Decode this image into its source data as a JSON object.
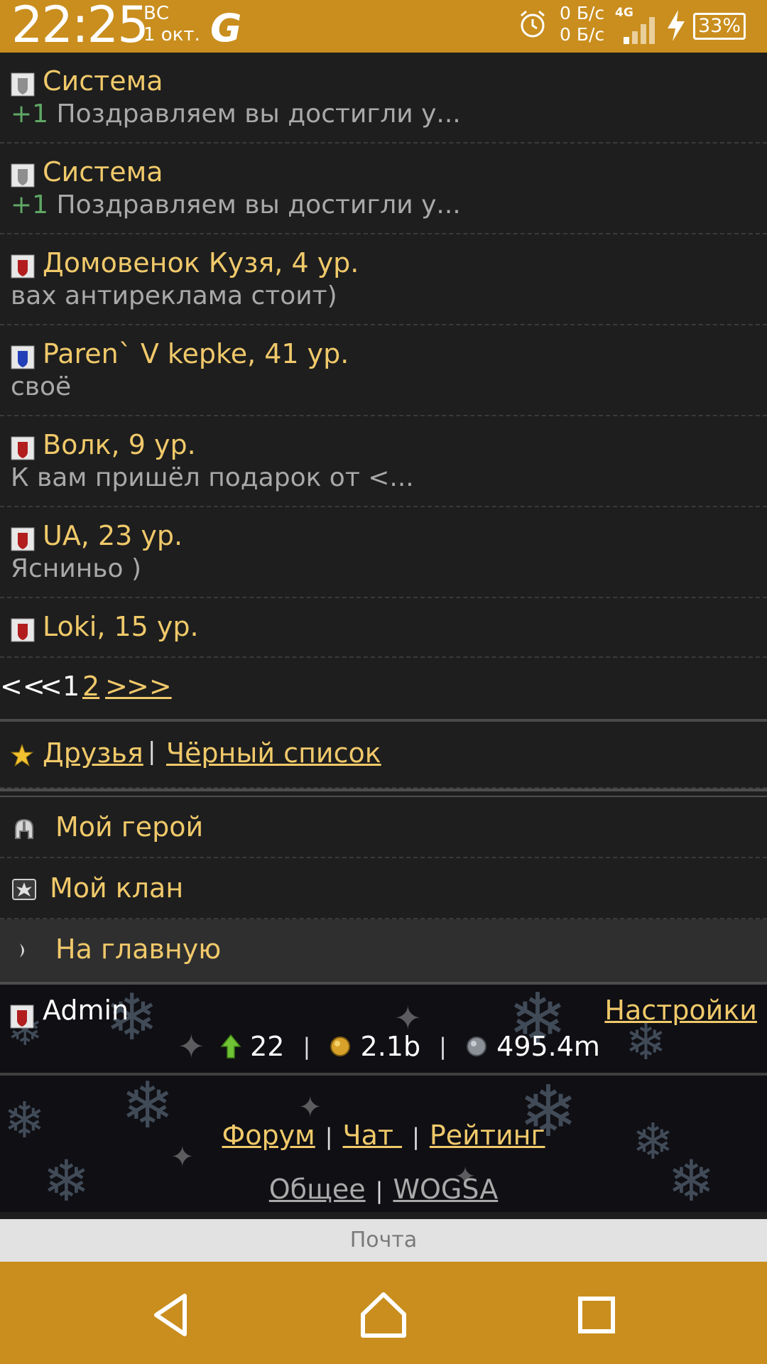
{
  "status_bar": {
    "time": "22:25",
    "day": "ВС",
    "date": "1 окт.",
    "app_badge": "G",
    "net_up": "0 Б/с",
    "net_down": "0 Б/с",
    "network_type": "4G",
    "battery": "33%"
  },
  "messages": [
    {
      "icon": "grey-shield-icon",
      "name": "Система",
      "plus": "+1",
      "text": " Поздравляем вы достигли у..."
    },
    {
      "icon": "grey-shield-icon",
      "name": "Система",
      "plus": "+1",
      "text": " Поздравляем вы достигли у..."
    },
    {
      "icon": "red-shield-icon",
      "name": "Домовенок Кузя, 4 ур.",
      "plus": "",
      "text": "вах антиреклама стоит)"
    },
    {
      "icon": "blue-shield-icon",
      "name": "Paren` V kepke, 41 ур.",
      "plus": "",
      "text": "своё"
    },
    {
      "icon": "red-shield-icon",
      "name": "Волк, 9 ур.",
      "plus": "",
      "text": "К вам пришёл подарок от <..."
    },
    {
      "icon": "red-shield-icon",
      "name": "UA, 23 ур.",
      "plus": "",
      "text": "Ясниньо )"
    },
    {
      "icon": "red-shield-icon",
      "name": "Loki, 15 ур.",
      "plus": "",
      "text": ""
    }
  ],
  "pager": {
    "first": "<<",
    "prev": "<",
    "current": "1",
    "page2": "2",
    "next": ">",
    "last": ">>"
  },
  "friends": {
    "friends_label": "Друзья",
    "separator": "|",
    "blacklist_label": "Чёрный список"
  },
  "menu": {
    "hero": "Мой герой",
    "clan": "Мой клан",
    "home": "На главную"
  },
  "user": {
    "name": "Admin",
    "settings": "Настройки",
    "level": "22",
    "gold": "2.1b",
    "silver": "495.4m",
    "separator": "|"
  },
  "links": {
    "forum": "Форум",
    "chat": "Чат ",
    "rating": "Рейтинг",
    "general": "Общее",
    "wogsa": "WOGSA",
    "separator": "|"
  },
  "footer": {
    "mail": "Почта"
  },
  "colors": {
    "accent": "#c98e1e",
    "gold_text": "#f0c96a",
    "plus_green": "#5fa765"
  }
}
